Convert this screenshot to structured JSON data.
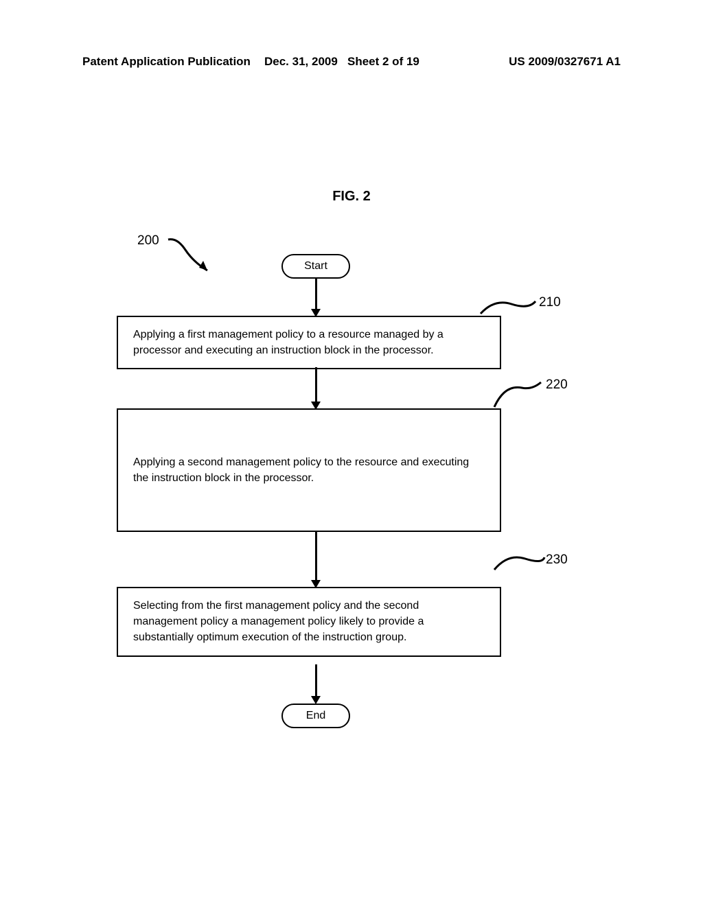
{
  "header": {
    "left": "Patent Application Publication",
    "mid_date": "Dec. 31, 2009",
    "mid_sheet": "Sheet 2 of 19",
    "right": "US 2009/0327671 A1"
  },
  "figure": {
    "title": "FIG. 2",
    "ref_main": "200",
    "terminals": {
      "start": "Start",
      "end": "End"
    },
    "steps": {
      "s1": {
        "ref": "210",
        "text": "Applying a first management policy to a resource managed by a processor and executing an instruction block in the processor."
      },
      "s2": {
        "ref": "220",
        "text": "Applying a second management policy to the resource and executing the instruction block in the processor."
      },
      "s3": {
        "ref": "230",
        "text": "Selecting from the first management policy and the second management policy a management policy likely to provide a substantially optimum execution of the instruction group."
      }
    }
  }
}
